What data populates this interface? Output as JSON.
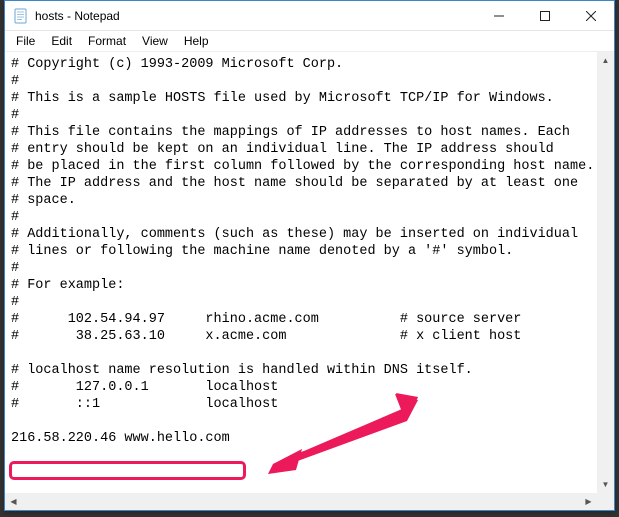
{
  "window": {
    "title": "hosts - Notepad"
  },
  "menubar": {
    "file": "File",
    "edit": "Edit",
    "format": "Format",
    "view": "View",
    "help": "Help"
  },
  "content": "# Copyright (c) 1993-2009 Microsoft Corp.\n#\n# This is a sample HOSTS file used by Microsoft TCP/IP for Windows.\n#\n# This file contains the mappings of IP addresses to host names. Each\n# entry should be kept on an individual line. The IP address should\n# be placed in the first column followed by the corresponding host name.\n# The IP address and the host name should be separated by at least one\n# space.\n#\n# Additionally, comments (such as these) may be inserted on individual\n# lines or following the machine name denoted by a '#' symbol.\n#\n# For example:\n#\n#      102.54.94.97     rhino.acme.com          # source server\n#       38.25.63.10     x.acme.com              # x client host\n\n# localhost name resolution is handled within DNS itself.\n#       127.0.0.1       localhost\n#       ::1             localhost\n\n216.58.220.46 www.hello.com",
  "annotation": {
    "color": "#ec1a5b"
  }
}
